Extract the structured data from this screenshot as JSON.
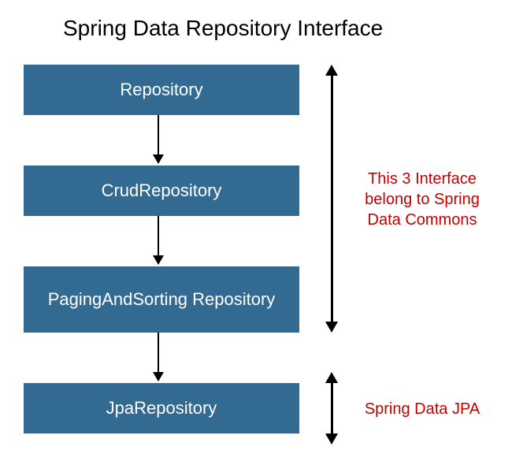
{
  "title": "Spring Data Repository Interface",
  "boxes": [
    {
      "label": "Repository"
    },
    {
      "label": "CrudRepository"
    },
    {
      "label": "PagingAndSorting Repository"
    },
    {
      "label": "JpaRepository"
    }
  ],
  "annotations": [
    {
      "text": "This 3 Interface belong to Spring Data Commons"
    },
    {
      "text": "Spring Data JPA"
    }
  ],
  "colors": {
    "box_bg": "#336a92",
    "box_text": "#ffffff",
    "annotation_text": "#c00000",
    "arrow": "#000000"
  }
}
